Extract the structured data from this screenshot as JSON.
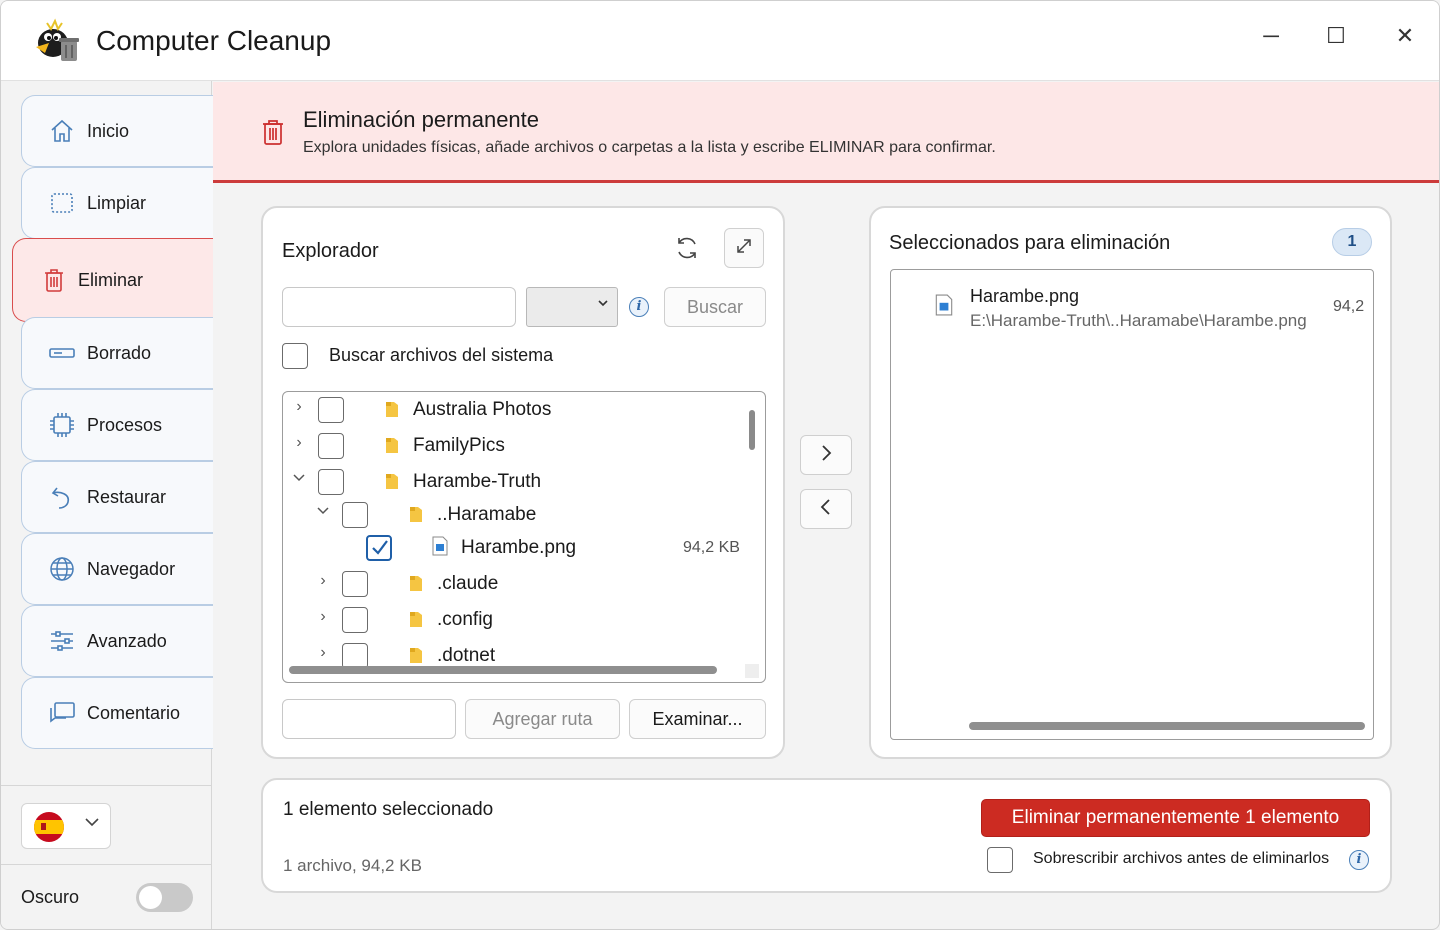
{
  "window": {
    "title": "Computer Cleanup",
    "controls": {
      "minimize": "─",
      "maximize": "☐",
      "close": "✕"
    }
  },
  "sidebar": {
    "items": [
      {
        "label": "Inicio",
        "icon": "home-icon",
        "active": false
      },
      {
        "label": "Limpiar",
        "icon": "broom-icon",
        "active": false
      },
      {
        "label": "Eliminar",
        "icon": "trash-icon",
        "active": true
      },
      {
        "label": "Borrado",
        "icon": "drive-icon",
        "active": false
      },
      {
        "label": "Procesos",
        "icon": "cpu-icon",
        "active": false
      },
      {
        "label": "Restaurar",
        "icon": "undo-icon",
        "active": false
      },
      {
        "label": "Navegador",
        "icon": "globe-icon",
        "active": false
      },
      {
        "label": "Avanzado",
        "icon": "sliders-icon",
        "active": false
      },
      {
        "label": "Comentario",
        "icon": "comment-icon",
        "active": false
      }
    ],
    "language": {
      "flag": "spain-flag-icon",
      "value": "es"
    },
    "dark_mode": {
      "label": "Oscuro",
      "on": false
    }
  },
  "banner": {
    "title": "Eliminación permanente",
    "subtitle": "Explora unidades físicas, añade archivos o carpetas a la lista y escribe ELIMINAR para confirmar.",
    "accent": "#cc3b3b"
  },
  "explorer": {
    "title": "Explorador",
    "search_value": "",
    "drive_value": "",
    "search_button": "Buscar",
    "system_files_label": "Buscar archivos del sistema",
    "system_files_checked": false,
    "tree": [
      {
        "name": "Australia Photos",
        "type": "folder",
        "depth": 0,
        "expanded": false,
        "checked": false,
        "size": ""
      },
      {
        "name": "FamilyPics",
        "type": "folder",
        "depth": 0,
        "expanded": false,
        "checked": false,
        "size": ""
      },
      {
        "name": "Harambe-Truth",
        "type": "folder",
        "depth": 0,
        "expanded": true,
        "checked": false,
        "size": ""
      },
      {
        "name": "..Haramabe",
        "type": "folder",
        "depth": 1,
        "expanded": true,
        "checked": false,
        "size": ""
      },
      {
        "name": "Harambe.png",
        "type": "file",
        "depth": 2,
        "expanded": false,
        "checked": true,
        "size": "94,2 KB"
      },
      {
        "name": ".claude",
        "type": "folder",
        "depth": 1,
        "expanded": false,
        "checked": false,
        "size": ""
      },
      {
        "name": ".config",
        "type": "folder",
        "depth": 1,
        "expanded": false,
        "checked": false,
        "size": ""
      },
      {
        "name": ".dotnet",
        "type": "folder",
        "depth": 1,
        "expanded": false,
        "checked": false,
        "size": ""
      }
    ],
    "path_value": "",
    "add_path_button": "Agregar ruta",
    "browse_button": "Examinar..."
  },
  "transfer": {
    "add": "›",
    "remove": "‹"
  },
  "selected": {
    "title": "Seleccionados para eliminación",
    "count": "1",
    "items": [
      {
        "name": "Harambe.png",
        "path": "E:\\Harambe-Truth\\..Haramabe\\Harambe.png",
        "size": "94,2"
      }
    ]
  },
  "summary": {
    "title": "1 elemento seleccionado",
    "detail": "1 archivo, 94,2 KB",
    "delete_button": "Eliminar permanentemente 1 elemento",
    "overwrite_label": "Sobrescribir archivos antes de eliminarlos",
    "overwrite_checked": false,
    "danger_color": "#cc2b22"
  }
}
